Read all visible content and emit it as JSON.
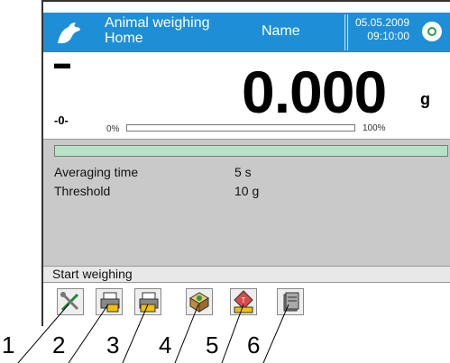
{
  "header": {
    "app_name": "Animal weighing",
    "location": "Home",
    "user": "Name",
    "date": "05.05.2009",
    "time": "09:10:00"
  },
  "weighing": {
    "value": "0.000",
    "unit": "g",
    "stable_symbol": "▬",
    "zero_symbol": "-0-",
    "bargraph_min": "0%",
    "bargraph_max": "100%",
    "bargraph_fill": 0
  },
  "info": {
    "rows": [
      {
        "label": "Averaging time",
        "value": "5 s"
      },
      {
        "label": "Threshold",
        "value": "10 g"
      }
    ]
  },
  "footer": {
    "status": "Start weighing",
    "buttons": [
      {
        "icon": "tools-icon"
      },
      {
        "icon": "printer-yellow-icon"
      },
      {
        "icon": "printer-yellow-2-icon"
      },
      {
        "icon": "box-icon"
      },
      {
        "icon": "tare-icon"
      },
      {
        "icon": "database-icon"
      }
    ]
  },
  "callouts": [
    "1",
    "2",
    "3",
    "4",
    "5",
    "6"
  ],
  "colors": {
    "header_bg": "#1e8fd6",
    "info_bg": "#c9c9c9",
    "progress_green": "#b6e3c4"
  }
}
